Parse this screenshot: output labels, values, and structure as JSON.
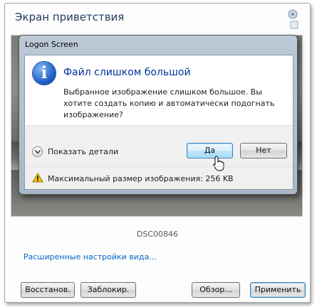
{
  "window": {
    "title": "Экран приветствия",
    "photo_name": "DSC00846",
    "advanced_link": "Расширенные настройки вида...",
    "buttons": {
      "restore": "Восстанов.",
      "lock": "Заблокир.",
      "browse": "Обзор...",
      "apply": "Применить"
    }
  },
  "dialog": {
    "title": "Logon Screen",
    "heading": "Файл слишком большой",
    "message": "Выбранное изображение слишком большое. Вы хотите создать копию и автоматически подогнать изображение?",
    "details_label": "Показать детали",
    "yes_label": "Да",
    "no_label": "Нет",
    "footer_text": "Максимальный размер изображения: 256 KB"
  },
  "colors": {
    "heading": "#003399",
    "link": "#0066cc",
    "dialog_frame": "#b3c2d2"
  }
}
